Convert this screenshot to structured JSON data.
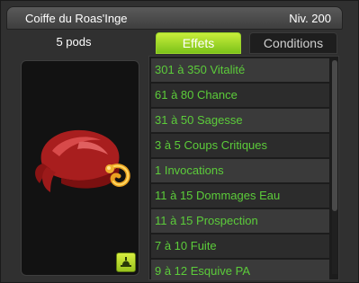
{
  "window": {
    "title": "Coiffe du Roas'Inge",
    "level": "Niv. 200"
  },
  "item": {
    "weight": "5 pods",
    "image_icon": "red-bandana-hat-icon",
    "type_icon": "hat-type-icon"
  },
  "tabs": [
    {
      "label": "Effets",
      "active": true
    },
    {
      "label": "Conditions",
      "active": false
    }
  ],
  "effects": [
    "301 à 350 Vitalité",
    "61 à 80 Chance",
    "31 à 50 Sagesse",
    "3 à 5 Coups Critiques",
    "1 Invocations",
    "11 à 15 Dommages Eau",
    "11 à 15 Prospection",
    "7 à 10 Fuite",
    "9 à 12 Esquive PA"
  ],
  "colors": {
    "effect_text": "#5ccc3a",
    "active_tab": "#9ad42a",
    "background": "#303030"
  }
}
